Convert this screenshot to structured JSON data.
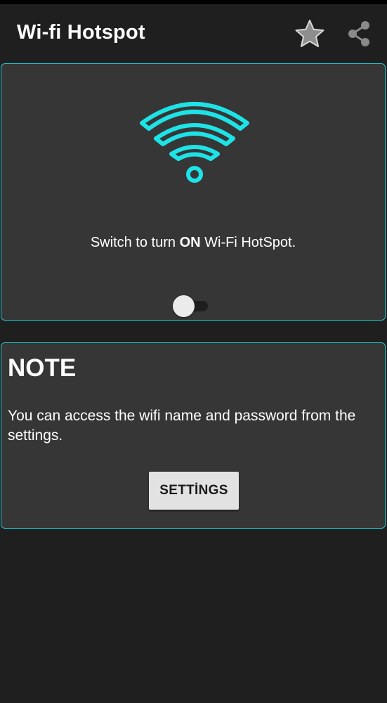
{
  "app_bar": {
    "title": "Wi-fi Hotspot",
    "icons": [
      "star-icon",
      "share-icon"
    ]
  },
  "hotspot_card": {
    "icon": "wifi-icon",
    "switch_text_before": "Switch to turn ",
    "switch_text_bold": "ON",
    "switch_text_after": " Wi-Fi HotSpot.",
    "toggle_state": "off"
  },
  "note_card": {
    "title": "NOTE",
    "body": "You can access the wifi name and password from the settings.",
    "settings_label": "SETTİNGS"
  },
  "colors": {
    "background": "#1f1f20",
    "card_background": "#373637",
    "accent": "#21c6cc",
    "wifi_icon": "#1ee3e6",
    "button_background": "#e2e2e2"
  }
}
